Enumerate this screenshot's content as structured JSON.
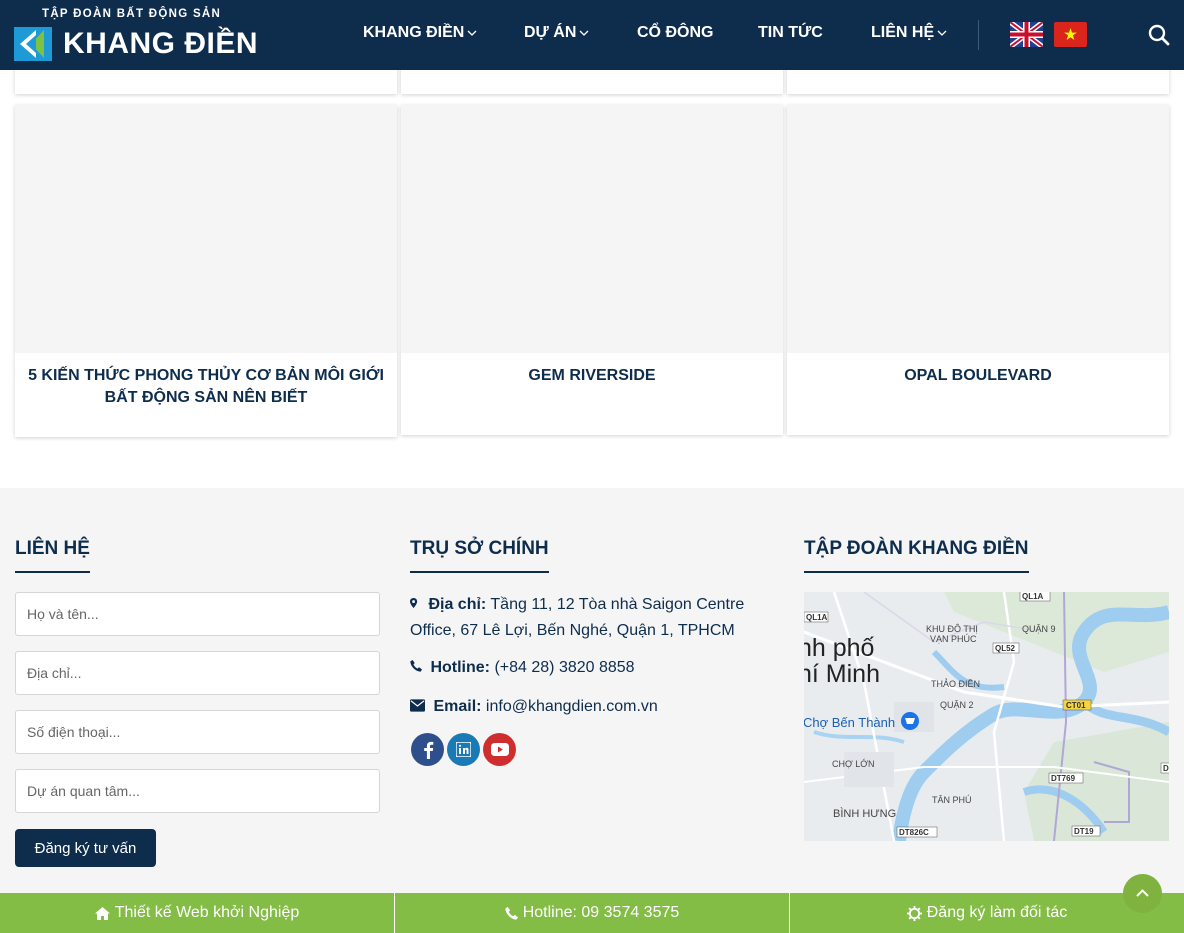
{
  "header": {
    "logo_tagline": "TẬP ĐOÀN BẤT ĐỘNG SẢN",
    "logo_name": "KHANG ĐIỀN",
    "nav": [
      {
        "label": "KHANG ĐIỀN",
        "has_dropdown": true
      },
      {
        "label": "DỰ ÁN",
        "has_dropdown": true
      },
      {
        "label": "CỔ ĐÔNG",
        "has_dropdown": false
      },
      {
        "label": "TIN TỨC",
        "has_dropdown": false
      },
      {
        "label": "LIÊN HỆ",
        "has_dropdown": true
      }
    ],
    "languages": [
      "en-flag-icon",
      "vn-flag-icon"
    ],
    "search_icon": "search-icon"
  },
  "cards": [
    {
      "title": "5 KIẾN THỨC PHONG THỦY CƠ BẢN MÔI GIỚI BẤT ĐỘNG SẢN NÊN BIẾT"
    },
    {
      "title": "GEM RIVERSIDE"
    },
    {
      "title": "OPAL BOULEVARD"
    }
  ],
  "footer": {
    "contact": {
      "heading": "LIÊN HỆ",
      "name_placeholder": "Họ và tên...",
      "address_placeholder": "Địa chỉ...",
      "phone_placeholder": "Số điện thoại...",
      "project_placeholder": "Dự án quan tâm...",
      "submit_label": "Đăng ký tư vấn"
    },
    "office": {
      "heading": "TRỤ SỞ CHÍNH",
      "address_label": "Địa chỉ:",
      "address_line1": "Tầng 11, 12 Tòa nhà Saigon Centre",
      "address_line2": "Office, 67 Lê Lợi, Bến Nghé, Quận 1, TPHCM",
      "hotline_label": "Hotline:",
      "hotline_value": "(+84 28) 3820 8858",
      "email_label": "Email:",
      "email_value": "info@khangdien.com.vn",
      "socials": [
        "facebook-icon",
        "linkedin-icon",
        "youtube-icon"
      ]
    },
    "group": {
      "heading": "TẬP ĐOÀN KHANG ĐIỀN",
      "map_labels": {
        "ql1a_top": "QL1A",
        "ql1a": "QL1A",
        "city1": "nh phố",
        "city2": "hí Minh",
        "khu_do_thi": "KHU ĐÔ THỊ",
        "van_phuc": "VẠN PHÚC",
        "quan9": "QUẬN 9",
        "ql52": "QL52",
        "thao_dien": "THẢO ĐIỀN",
        "quan2": "QUẬN 2",
        "ct01": "CT01",
        "cho_ben_thanh": "Chợ Bến Thành",
        "cho_lon": "CHỢ LỚN",
        "dt769": "DT769",
        "tan_phu": "TÂN PHÚ",
        "binh_hung": "BÌNH HƯNG",
        "dt826c": "DT826C",
        "dt19": "DT19",
        "d_cut": "D"
      }
    }
  },
  "bottom_bar": [
    {
      "icon": "home-icon",
      "label": "Thiết kế Web khởi Nghiệp"
    },
    {
      "icon": "phone-icon",
      "label": "Hotline: 09 3574 3575"
    },
    {
      "icon": "gear-icon",
      "label": "Đăng ký làm đối tác"
    }
  ],
  "colors": {
    "navy": "#0e2d4d",
    "green": "#84bd45",
    "footer_bg": "#f5f5f5"
  }
}
